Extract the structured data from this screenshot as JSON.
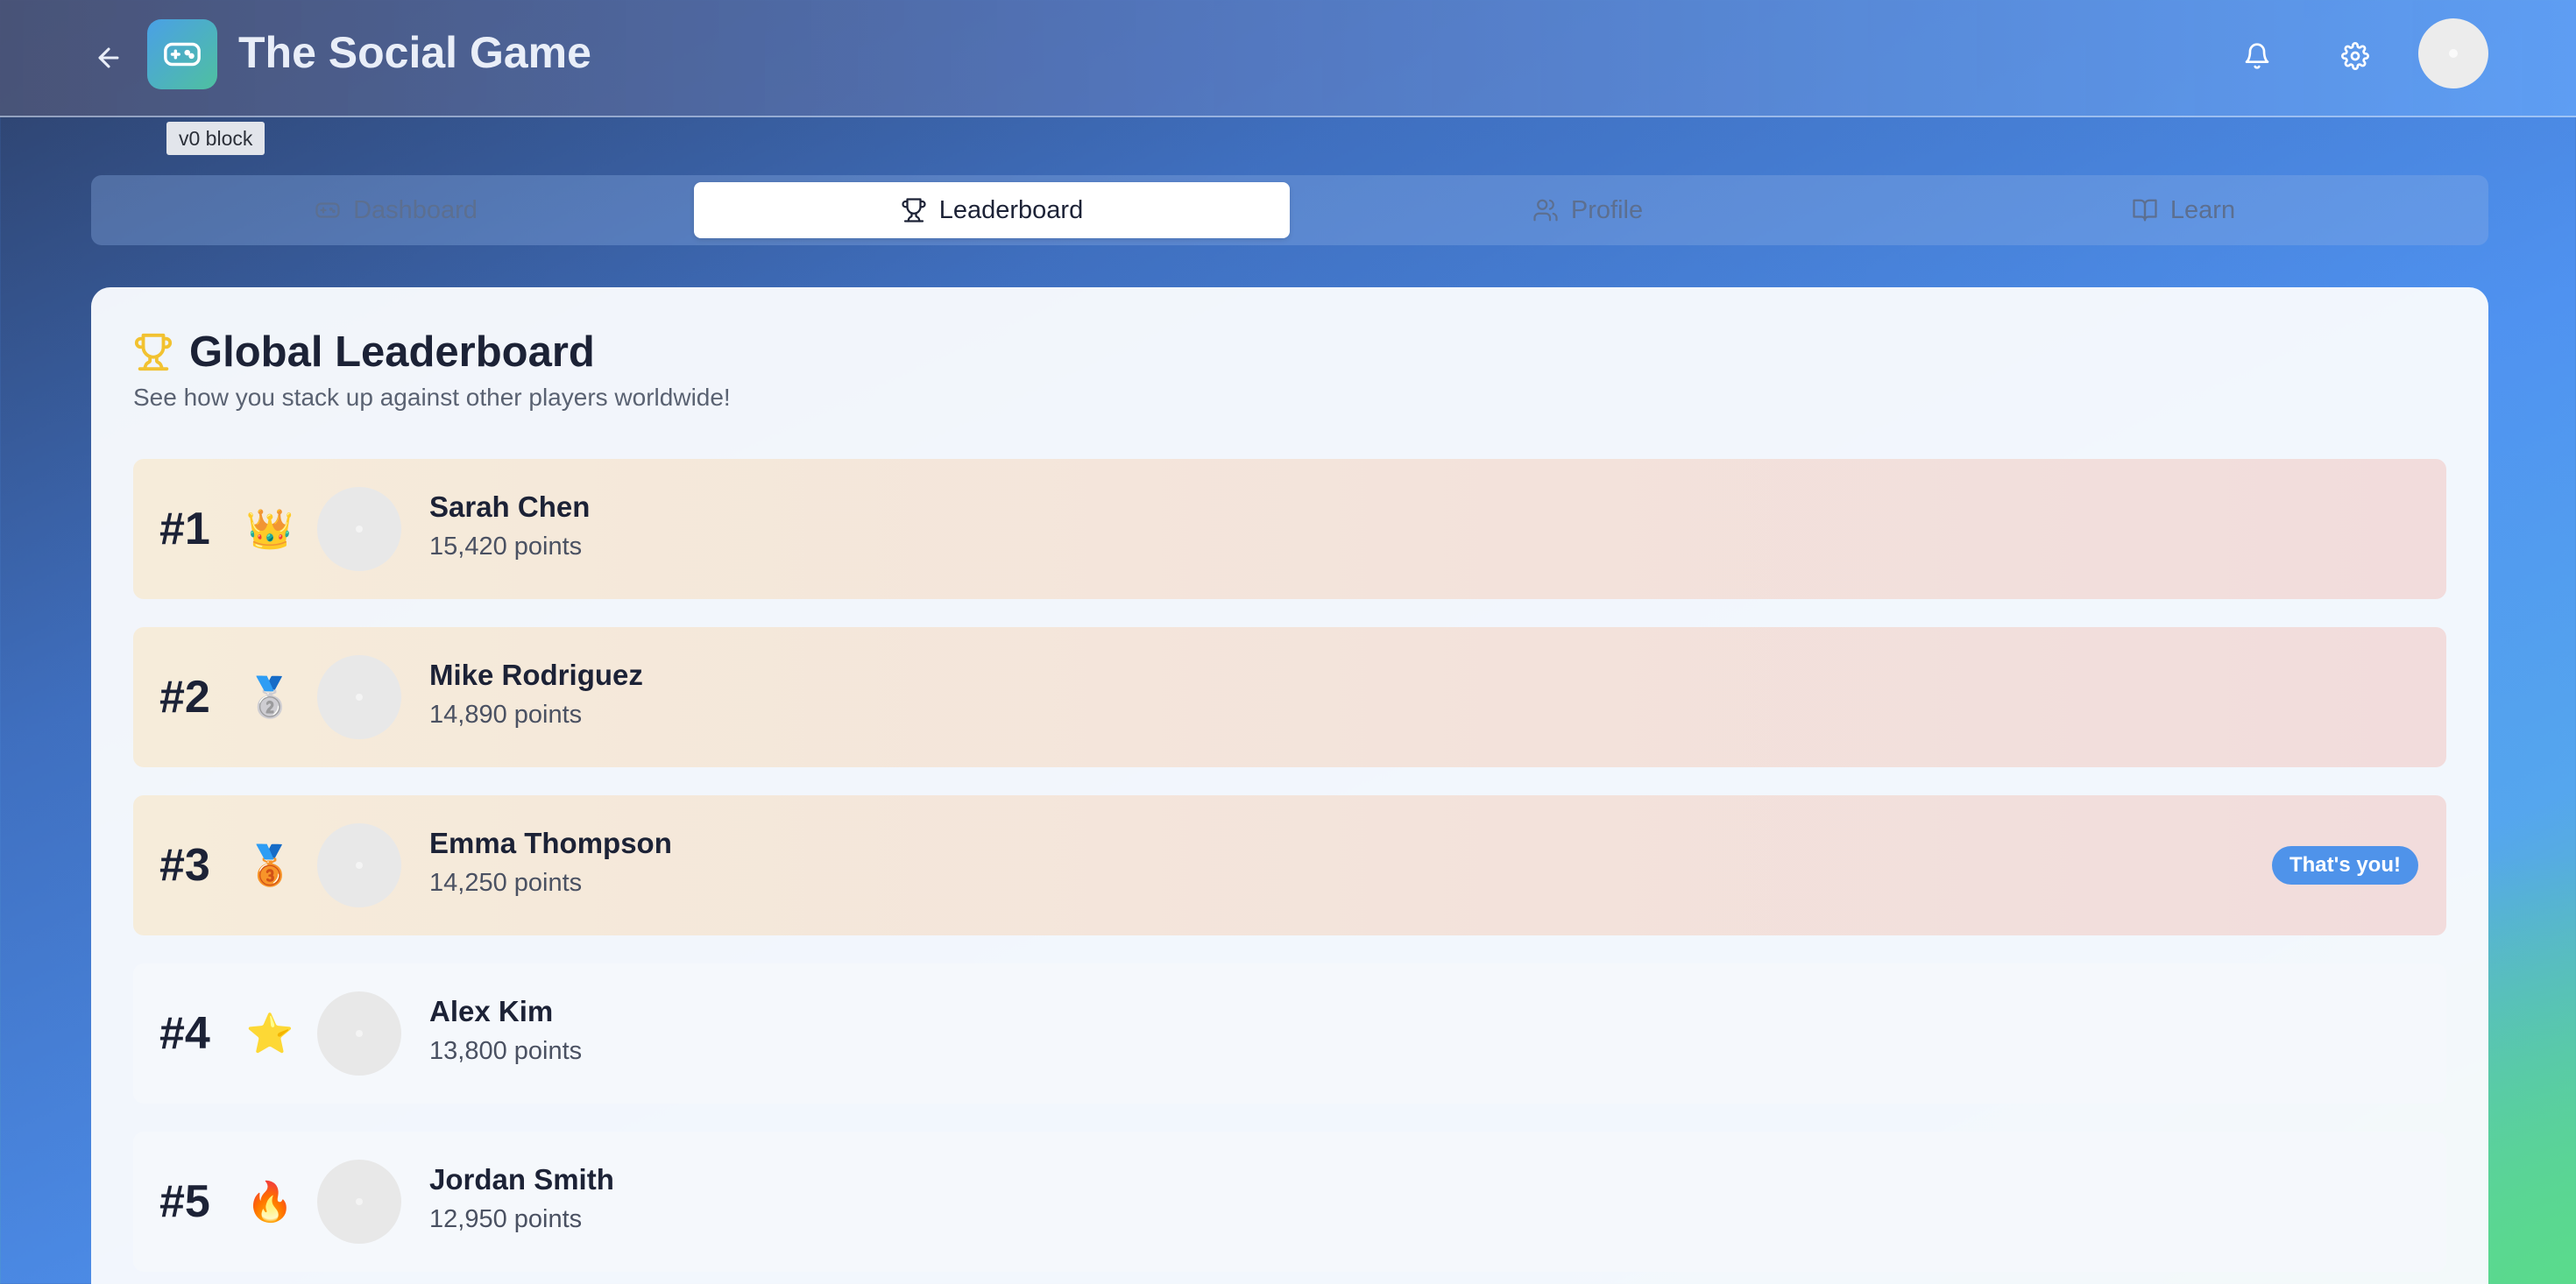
{
  "header": {
    "title": "The Social Game",
    "tooltip": "v0 block"
  },
  "tabs": [
    {
      "label": "Dashboard",
      "icon": "gamepad-icon",
      "active": false
    },
    {
      "label": "Leaderboard",
      "icon": "trophy-icon",
      "active": true
    },
    {
      "label": "Profile",
      "icon": "users-icon",
      "active": false
    },
    {
      "label": "Learn",
      "icon": "book-icon",
      "active": false
    }
  ],
  "leaderboard": {
    "title": "Global Leaderboard",
    "subtitle": "See how you stack up against other players worldwide!",
    "you_badge": "That's you!",
    "players": [
      {
        "rank": "#1",
        "badge": "👑",
        "name": "Sarah Chen",
        "points": "15,420 points"
      },
      {
        "rank": "#2",
        "badge": "🥈",
        "name": "Mike Rodriguez",
        "points": "14,890 points"
      },
      {
        "rank": "#3",
        "badge": "🥉",
        "name": "Emma Thompson",
        "points": "14,250 points"
      },
      {
        "rank": "#4",
        "badge": "⭐",
        "name": "Alex Kim",
        "points": "13,800 points"
      },
      {
        "rank": "#5",
        "badge": "🔥",
        "name": "Jordan Smith",
        "points": "12,950 points"
      }
    ]
  },
  "colors": {
    "accent": "#4f93ea",
    "trophy": "#f2c230",
    "text_dark": "#1c2236"
  }
}
